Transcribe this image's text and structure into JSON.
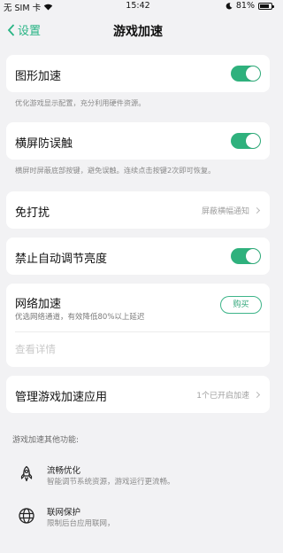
{
  "status_bar": {
    "carrier": "无 SIM 卡",
    "time": "15:42",
    "battery_text": "81%",
    "battery_level": 0.81
  },
  "nav": {
    "back_label": "设置",
    "title": "游戏加速"
  },
  "settings": {
    "graphics_accel": {
      "label": "图形加速",
      "enabled": true,
      "desc": "优化游戏显示配置，充分利用硬件资源。"
    },
    "landscape_touch": {
      "label": "横屏防误触",
      "enabled": true,
      "desc": "横屏时屏蔽底部按键，避免误触。连续点击按键2次即可恢复。"
    },
    "dnd": {
      "label": "免打扰",
      "value": "屏蔽横幅通知"
    },
    "auto_brightness": {
      "label": "禁止自动调节亮度",
      "enabled": true
    },
    "network_accel": {
      "label": "网络加速",
      "desc": "优选网络通道，有效降低80%以上延迟",
      "buy_label": "购买",
      "details_link": "查看详情"
    },
    "manage_apps": {
      "label": "管理游戏加速应用",
      "value": "1个已开启加速"
    }
  },
  "other_features": {
    "title": "游戏加速其他功能:",
    "items": [
      {
        "icon": "rocket-icon",
        "title": "流畅优化",
        "desc": "智能调节系统资源，游戏运行更流畅。"
      },
      {
        "icon": "globe-icon",
        "title": "联网保护",
        "desc": "限制后台应用联网，"
      }
    ]
  },
  "colors": {
    "accent": "#2fb17d",
    "background": "#f2f2f4"
  }
}
